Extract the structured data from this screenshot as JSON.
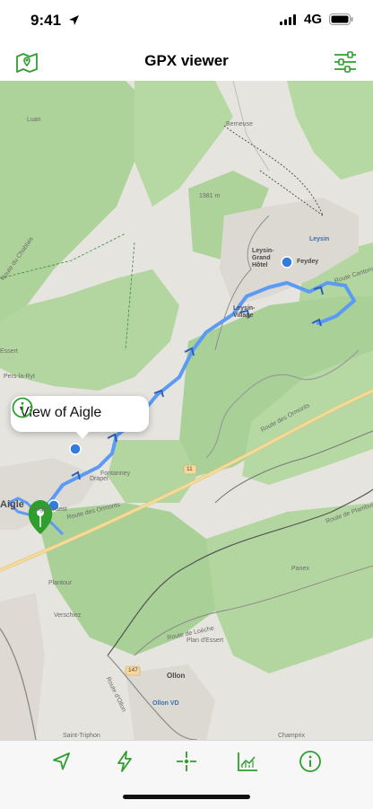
{
  "status_bar": {
    "time": "9:41",
    "network": "4G"
  },
  "nav": {
    "title": "GPX viewer",
    "left_icon": "map-pin-icon",
    "right_icon": "sliders-icon"
  },
  "map": {
    "labels": {
      "luan": "Luan",
      "berneuse": "Berneuse",
      "leysin_grand_hotel": "Leysin-Grand Hôtel",
      "altitude_1981": "1981 m",
      "leysin": "Leysin",
      "leysin_feydey": "Feydey",
      "route_cantonale": "Route Cantonale",
      "leysin_village": "Leysin-Village",
      "essert": "Essert",
      "pers_la_ryt": "Pers-la-Ryt",
      "drapel": "Drapel",
      "fontanney": "Fontanney",
      "route_ormonts_1": "Route des Ormonts",
      "route_ormonts_2": "Route des Ormonts",
      "road_11": "11",
      "aigle": "Aigle",
      "aigle_gare": "Aigle-Ouest",
      "plantour": "Plantour",
      "panex": "Panex",
      "route_plambuit": "Route de Plambuit",
      "verschiez": "Verschiez",
      "route_ollon": "Route d'Ollon",
      "plan_essert": "Plan d'Essert",
      "road_147": "147",
      "ollon": "Ollon",
      "ollon_vd": "Ollon VD",
      "saint_triphon": "Saint-Triphon",
      "champrix": "Champrix",
      "route_chablais": "Route du Chablais",
      "route_loeb": "Route de Loèche"
    },
    "route_color": "#5b9af5",
    "pin_color": "#2f9e2f"
  },
  "callout": {
    "title": "View of Aigle",
    "icon": "info-icon"
  },
  "toolbar": {
    "items": [
      {
        "icon": "location-arrow-icon"
      },
      {
        "icon": "bolt-icon"
      },
      {
        "icon": "crosshair-icon"
      },
      {
        "icon": "elevation-chart-icon"
      },
      {
        "icon": "info-icon"
      }
    ],
    "accent": "#2f9e2f"
  }
}
